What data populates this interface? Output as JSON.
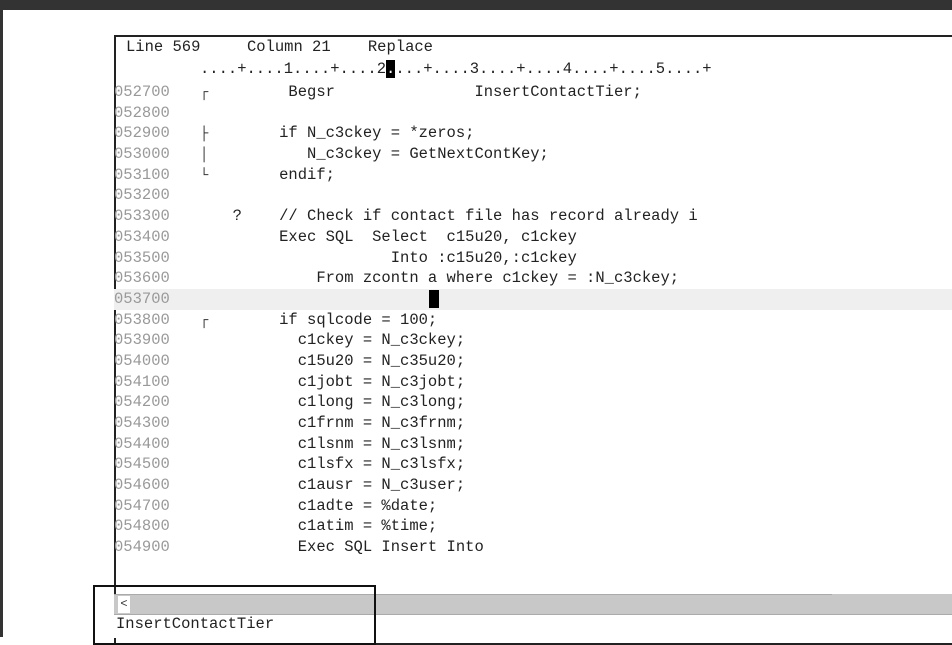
{
  "status": {
    "line_label": "Line 569",
    "column_label": "Column 21",
    "mode": "Replace"
  },
  "ruler": {
    "before": "....+....1....+....2",
    "cursor_char": ".",
    "after": "...+....3....+....4....+....5....+"
  },
  "lines": [
    {
      "num": "052700",
      "marker": "┌",
      "code": "        Begsr               InsertContactTier;"
    },
    {
      "num": "052800",
      "marker": "",
      "code": ""
    },
    {
      "num": "052900",
      "marker": "├",
      "code": "       if N_c3ckey = *zeros;"
    },
    {
      "num": "053000",
      "marker": "│",
      "code": "          N_c3ckey = GetNextContKey;"
    },
    {
      "num": "053100",
      "marker": "└",
      "code": "       endif;"
    },
    {
      "num": "053200",
      "marker": "",
      "code": ""
    },
    {
      "num": "053300",
      "marker": "",
      "code": "  ?    // Check if contact file has record already i"
    },
    {
      "num": "053400",
      "marker": "",
      "code": "       Exec SQL  Select  c15u20, c1ckey"
    },
    {
      "num": "053500",
      "marker": "",
      "code": "                   Into :c15u20,:c1ckey"
    },
    {
      "num": "053600",
      "marker": "",
      "code": "           From zcontn a where c1ckey = :N_c3ckey;"
    },
    {
      "num": "053700",
      "marker": "",
      "code": "",
      "cursor": true
    },
    {
      "num": "053800",
      "marker": "┌",
      "code": "       if sqlcode = 100;"
    },
    {
      "num": "053900",
      "marker": "",
      "code": "         c1ckey = N_c3ckey;"
    },
    {
      "num": "054000",
      "marker": "",
      "code": "         c15u20 = N_c35u20;"
    },
    {
      "num": "054100",
      "marker": "",
      "code": "         c1jobt = N_c3jobt;"
    },
    {
      "num": "054200",
      "marker": "",
      "code": "         c1long = N_c3long;"
    },
    {
      "num": "054300",
      "marker": "",
      "code": "         c1frnm = N_c3frnm;"
    },
    {
      "num": "054400",
      "marker": "",
      "code": "         c1lsnm = N_c3lsnm;"
    },
    {
      "num": "054500",
      "marker": "",
      "code": "         c1lsfx = N_c3lsfx;"
    },
    {
      "num": "054600",
      "marker": "",
      "code": "         c1ausr = N_c3user;"
    },
    {
      "num": "054700",
      "marker": "",
      "code": "         c1adte = %date;"
    },
    {
      "num": "054800",
      "marker": "",
      "code": "         c1atim = %time;"
    },
    {
      "num": "054900",
      "marker": "",
      "code": "         Exec SQL Insert Into"
    }
  ],
  "scrollbar": {
    "left_arrow": "<"
  },
  "subroutine_label": "InsertContactTier"
}
